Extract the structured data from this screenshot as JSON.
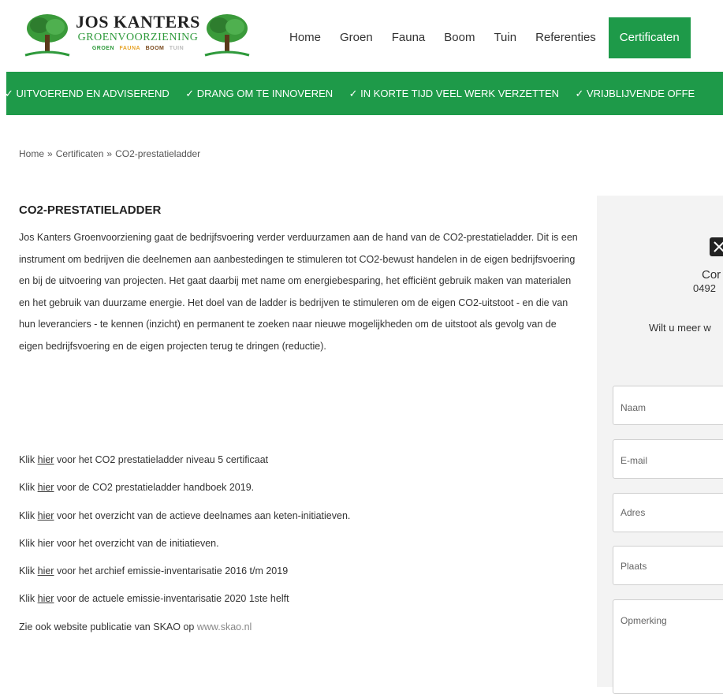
{
  "header": {
    "brand_name": "JOS KANTERS",
    "brand_sub": "GROENVOORZIENING",
    "brand_tags": [
      "GROEN",
      "FAUNA",
      "BOOM",
      "TUIN"
    ],
    "nav": [
      "Home",
      "Groen",
      "Fauna",
      "Boom",
      "Tuin",
      "Referenties",
      "Certificaten"
    ],
    "active_nav": "Certificaten"
  },
  "usp": [
    "✓ UITVOEREND EN ADVISEREND",
    "✓ DRANG OM TE INNOVEREN",
    "✓ IN KORTE TIJD VEEL WERK VERZETTEN",
    "✓ VRIJBLIJVENDE OFFE"
  ],
  "breadcrumb": {
    "home": "Home",
    "sep": "»",
    "section": "Certificaten",
    "current": "CO2-prestatieladder"
  },
  "main": {
    "title": "CO2-PRESTATIELADDER",
    "intro": "Jos Kanters Groenvoorziening  gaat de bedrijfsvoering verder verduurzamen aan de hand van de CO2-prestatieladder. Dit is een instrument om bedrijven die deelnemen aan aanbestedingen te stimuleren tot CO2-bewust handelen in de eigen bedrijfsvoering en bij de uitvoering van projecten. Het gaat daarbij met name om energiebesparing, het efficiënt gebruik maken van materialen en het gebruik van duurzame energie. Het doel van de ladder is bedrijven te stimuleren om de eigen CO2-uitstoot - en die van hun leveranciers - te kennen (inzicht) en permanent te zoeken naar nieuwe mogelijkheden om de uitstoot als gevolg van de eigen bedrijfsvoering en de eigen projecten terug te dringen (reductie).",
    "links": [
      {
        "pre": "Klik ",
        "link": "hier",
        "post": " voor het CO2 prestatieladder niveau 5 certificaat"
      },
      {
        "pre": "Klik ",
        "link": "hier",
        "post": " voor de CO2 prestatieladder handboek 2019."
      },
      {
        "pre": "Klik ",
        "link": "hier",
        "post": " voor het overzicht van de actieve deelnames aan keten-initiatieven."
      },
      {
        "pre": "Klik ",
        "link": "hier",
        "post": " voor het overzicht van de initiatieven."
      },
      {
        "pre": "Klik ",
        "link": "hier",
        "post": " voor het archief emissie-inventarisatie 2016 t/m 2019"
      },
      {
        "pre": "Klik ",
        "link": "hier",
        "post": " voor de actuele emissie-inventarisatie 2020 1ste helft"
      }
    ],
    "skao_pre": "Zie ook website publicatie van SKAO op ",
    "skao_link": "www.skao.nl"
  },
  "sidebar": {
    "title": "Cor",
    "phone": "0492",
    "question": "Wilt u meer w",
    "fields": {
      "naam": "Naam",
      "email": "E-mail",
      "adres": "Adres",
      "plaats": "Plaats",
      "opmerking": "Opmerking"
    }
  },
  "colors": {
    "brand_green": "#1e9a49",
    "sidebar_bg": "#f3f3f3"
  }
}
